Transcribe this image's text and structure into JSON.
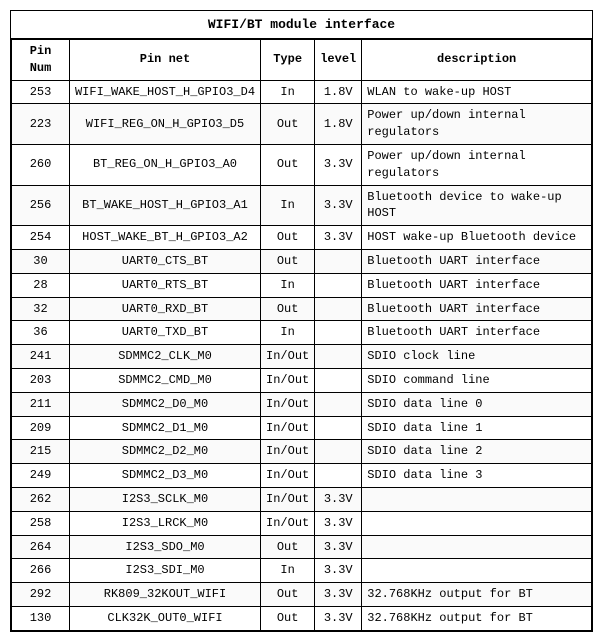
{
  "title": "WIFI/BT module interface",
  "columns": [
    "Pin Num",
    "Pin net",
    "Type",
    "level",
    "description"
  ],
  "rows": [
    {
      "pin_num": "253",
      "pin_net": "WIFI_WAKE_HOST_H_GPIO3_D4",
      "type": "In",
      "level": "1.8V",
      "description": "WLAN to wake-up HOST"
    },
    {
      "pin_num": "223",
      "pin_net": "WIFI_REG_ON_H_GPIO3_D5",
      "type": "Out",
      "level": "1.8V",
      "description": "Power up/down internal regulators"
    },
    {
      "pin_num": "260",
      "pin_net": "BT_REG_ON_H_GPIO3_A0",
      "type": "Out",
      "level": "3.3V",
      "description": "Power up/down internal regulators"
    },
    {
      "pin_num": "256",
      "pin_net": "BT_WAKE_HOST_H_GPIO3_A1",
      "type": "In",
      "level": "3.3V",
      "description": "Bluetooth device to wake-up HOST"
    },
    {
      "pin_num": "254",
      "pin_net": "HOST_WAKE_BT_H_GPIO3_A2",
      "type": "Out",
      "level": "3.3V",
      "description": "HOST wake-up Bluetooth device"
    },
    {
      "pin_num": "30",
      "pin_net": "UART0_CTS_BT",
      "type": "Out",
      "level": "",
      "description": "Bluetooth UART interface"
    },
    {
      "pin_num": "28",
      "pin_net": "UART0_RTS_BT",
      "type": "In",
      "level": "",
      "description": "Bluetooth UART interface"
    },
    {
      "pin_num": "32",
      "pin_net": "UART0_RXD_BT",
      "type": "Out",
      "level": "",
      "description": "Bluetooth UART interface"
    },
    {
      "pin_num": "36",
      "pin_net": "UART0_TXD_BT",
      "type": "In",
      "level": "",
      "description": "Bluetooth UART interface"
    },
    {
      "pin_num": "241",
      "pin_net": "SDMMC2_CLK_M0",
      "type": "In/Out",
      "level": "",
      "description": "SDIO clock line"
    },
    {
      "pin_num": "203",
      "pin_net": "SDMMC2_CMD_M0",
      "type": "In/Out",
      "level": "",
      "description": "SDIO command line"
    },
    {
      "pin_num": "211",
      "pin_net": "SDMMC2_D0_M0",
      "type": "In/Out",
      "level": "",
      "description": "SDIO data line 0"
    },
    {
      "pin_num": "209",
      "pin_net": "SDMMC2_D1_M0",
      "type": "In/Out",
      "level": "",
      "description": "SDIO data line 1"
    },
    {
      "pin_num": "215",
      "pin_net": "SDMMC2_D2_M0",
      "type": "In/Out",
      "level": "",
      "description": "SDIO data line 2"
    },
    {
      "pin_num": "249",
      "pin_net": "SDMMC2_D3_M0",
      "type": "In/Out",
      "level": "",
      "description": "SDIO data line 3"
    },
    {
      "pin_num": "262",
      "pin_net": "I2S3_SCLK_M0",
      "type": "In/Out",
      "level": "3.3V",
      "description": ""
    },
    {
      "pin_num": "258",
      "pin_net": "I2S3_LRCK_M0",
      "type": "In/Out",
      "level": "3.3V",
      "description": ""
    },
    {
      "pin_num": "264",
      "pin_net": "I2S3_SDO_M0",
      "type": "Out",
      "level": "3.3V",
      "description": ""
    },
    {
      "pin_num": "266",
      "pin_net": "I2S3_SDI_M0",
      "type": "In",
      "level": "3.3V",
      "description": ""
    },
    {
      "pin_num": "292",
      "pin_net": "RK809_32KOUT_WIFI",
      "type": "Out",
      "level": "3.3V",
      "description": "32.768KHz output for BT"
    },
    {
      "pin_num": "130",
      "pin_net": "CLK32K_OUT0_WIFI",
      "type": "Out",
      "level": "3.3V",
      "description": "32.768KHz output for BT"
    }
  ]
}
